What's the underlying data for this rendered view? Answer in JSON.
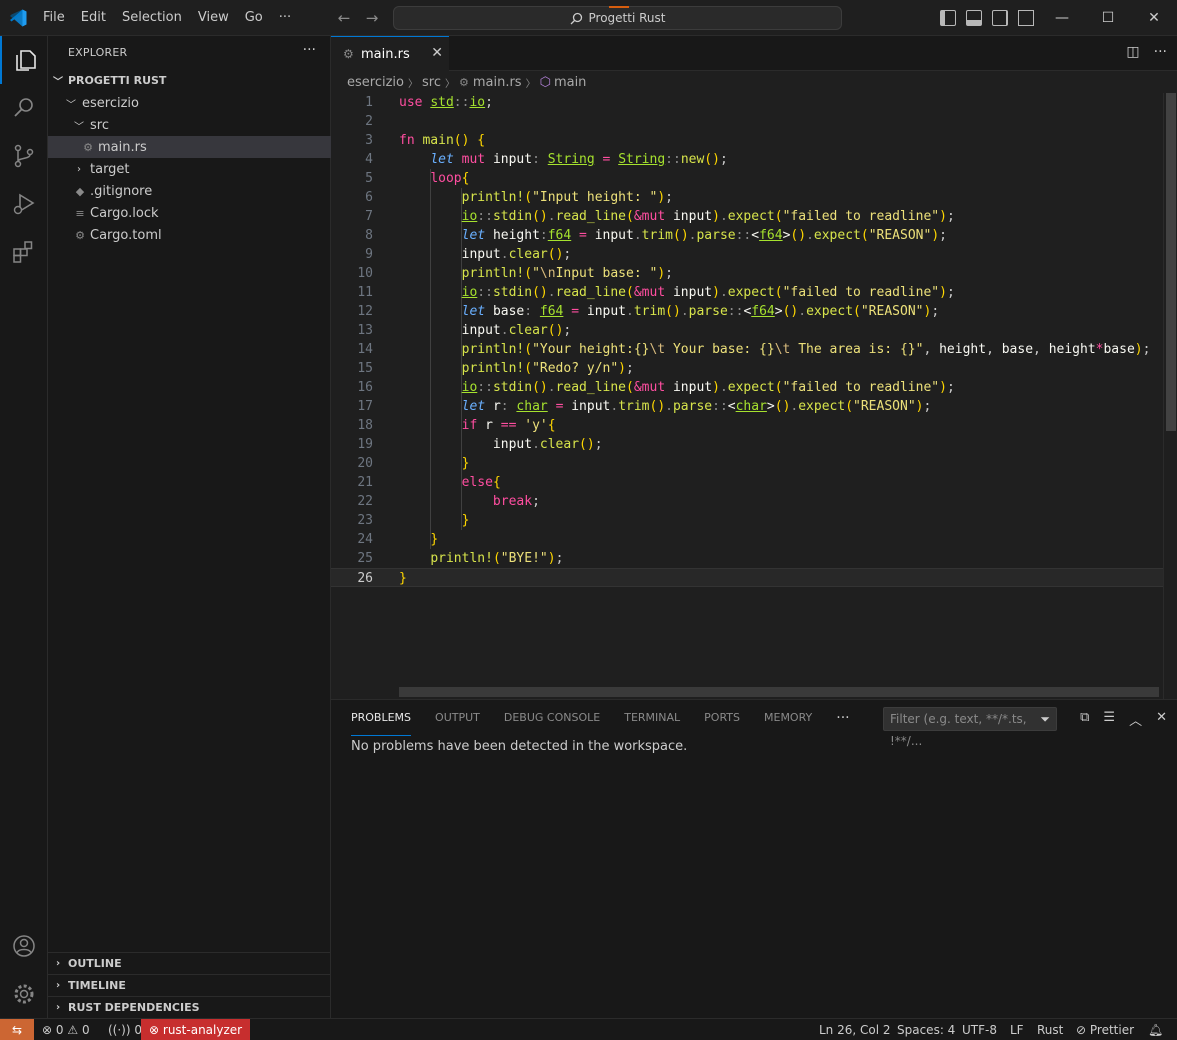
{
  "titlebar": {
    "menu": [
      "File",
      "Edit",
      "Selection",
      "View",
      "Go",
      "···"
    ],
    "search_text": "Progetti Rust",
    "win": [
      "—",
      "☐",
      "✕"
    ]
  },
  "sidebar": {
    "title": "EXPLORER",
    "more": "···",
    "project": "PROGETTI RUST",
    "tree": [
      {
        "label": "esercizio",
        "kind": "folder-open"
      },
      {
        "label": "src",
        "kind": "folder-open"
      },
      {
        "label": "main.rs",
        "kind": "file-rust",
        "selected": true
      },
      {
        "label": "target",
        "kind": "folder-closed"
      },
      {
        "label": ".gitignore",
        "kind": "file"
      },
      {
        "label": "Cargo.lock",
        "kind": "file-lock"
      },
      {
        "label": "Cargo.toml",
        "kind": "file-toml"
      }
    ],
    "sections": [
      "OUTLINE",
      "TIMELINE",
      "RUST DEPENDENCIES"
    ]
  },
  "tabs": [
    {
      "label": "main.rs",
      "close": "✕"
    }
  ],
  "breadcrumb": [
    "esercizio",
    "src",
    "main.rs",
    "main"
  ],
  "editor": {
    "current_line": 26,
    "lines": [
      "use std::io;",
      "",
      "fn main() {",
      "    let mut input: String = String::new();",
      "    loop{",
      "        println!(\"Input height: \");",
      "        io::stdin().read_line(&mut input).expect(\"failed to readline\");",
      "        let height:f64 = input.trim().parse::<f64>().expect(\"REASON\");",
      "        input.clear();",
      "        println!(\"\\nInput base: \");",
      "        io::stdin().read_line(&mut input).expect(\"failed to readline\");",
      "        let base: f64 = input.trim().parse::<f64>().expect(\"REASON\");",
      "        input.clear();",
      "        println!(\"Your height:{}\\t Your base: {}\\t The area is: {}\", height, base, height*base);",
      "        println!(\"Redo? y/n\");",
      "        io::stdin().read_line(&mut input).expect(\"failed to readline\");",
      "        let r: char = input.trim().parse::<char>().expect(\"REASON\");",
      "        if r == 'y'{",
      "            input.clear();",
      "        }",
      "        else{",
      "            break;",
      "        }",
      "    }",
      "    println!(\"BYE!\");",
      "}"
    ]
  },
  "panel": {
    "tabs": [
      "PROBLEMS",
      "OUTPUT",
      "DEBUG CONSOLE",
      "TERMINAL",
      "PORTS",
      "MEMORY"
    ],
    "active_tab": "PROBLEMS",
    "more": "···",
    "filter_placeholder": "Filter (e.g. text, **/*.ts, !**/...",
    "message": "No problems have been detected in the workspace."
  },
  "statusbar": {
    "errors": "0",
    "warnings": "0",
    "ports": "0",
    "rust_analyzer": "rust-analyzer",
    "position": "Ln 26, Col 2",
    "spaces": "Spaces: 4",
    "encoding": "UTF-8",
    "eol": "LF",
    "language": "Rust",
    "prettier": "Prettier"
  },
  "colors": {
    "accent": "#0078d4",
    "error_badge": "#c72e2e",
    "remote": "#cc6633"
  }
}
